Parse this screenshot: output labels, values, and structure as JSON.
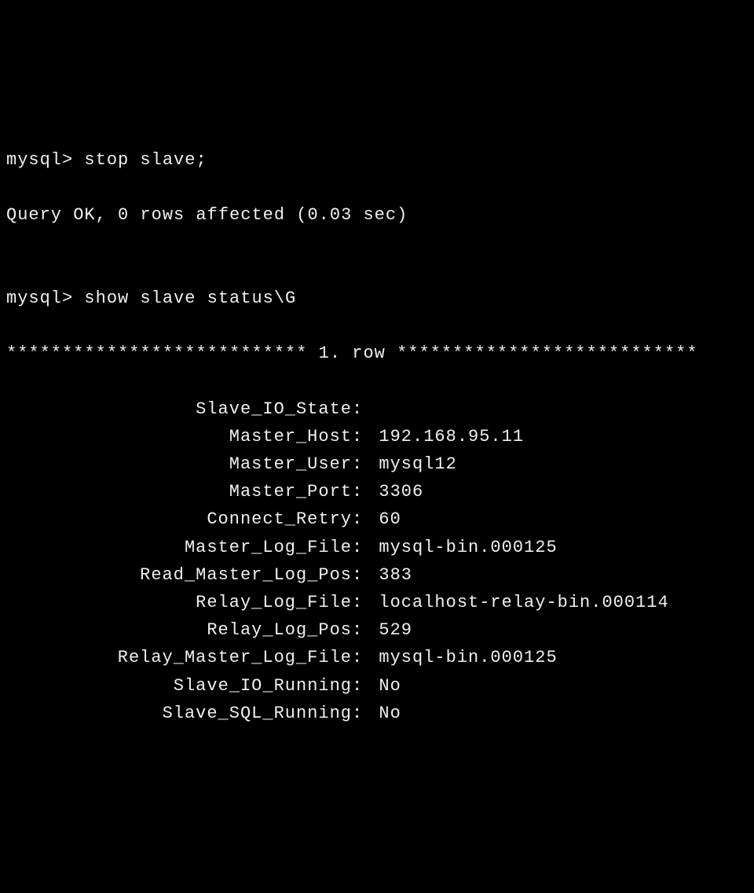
{
  "prompt1": "mysql>",
  "command1": "stop slave;",
  "response1": "Query OK, 0 rows affected (0.03 sec)",
  "blank": "",
  "prompt2": "mysql>",
  "command2": "show slave status\\G",
  "row_header": "*************************** 1. row ***************************",
  "status": [
    {
      "key": "Slave_IO_State",
      "value": ""
    },
    {
      "key": "Master_Host",
      "value": "192.168.95.11"
    },
    {
      "key": "Master_User",
      "value": "mysql12"
    },
    {
      "key": "Master_Port",
      "value": "3306"
    },
    {
      "key": "Connect_Retry",
      "value": "60"
    },
    {
      "key": "Master_Log_File",
      "value": "mysql-bin.000125"
    },
    {
      "key": "Read_Master_Log_Pos",
      "value": "383"
    },
    {
      "key": "Relay_Log_File",
      "value": "localhost-relay-bin.000114"
    },
    {
      "key": "Relay_Log_Pos",
      "value": "529"
    },
    {
      "key": "Relay_Master_Log_File",
      "value": "mysql-bin.000125"
    },
    {
      "key": "Slave_IO_Running",
      "value": "No"
    },
    {
      "key": "Slave_SQL_Running",
      "value": "No"
    }
  ]
}
